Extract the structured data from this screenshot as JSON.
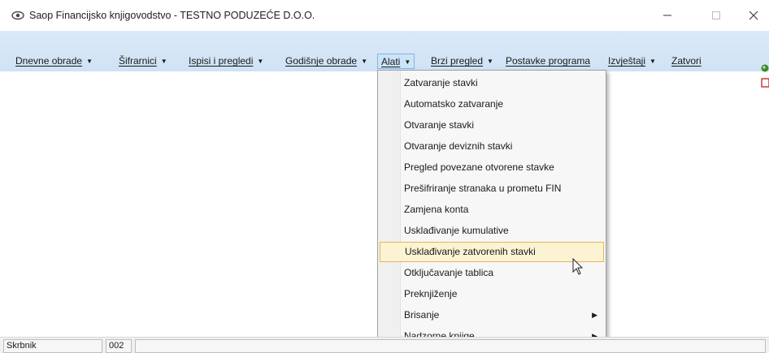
{
  "window": {
    "title": "Saop Financijsko knjigovodstvo - TESTNO PODUZEĆE D.O.O."
  },
  "menubar": {
    "items": [
      {
        "label": "Dnevne obrade"
      },
      {
        "label": "Šifrarnici"
      },
      {
        "label": "Ispisi i pregledi"
      },
      {
        "label": "Godišnje obrade"
      },
      {
        "label": "Alati"
      },
      {
        "label": "Brzi pregled"
      },
      {
        "label": "Postavke programa"
      },
      {
        "label": "Izvještaji"
      },
      {
        "label": "Zatvori"
      }
    ]
  },
  "alati_menu": {
    "items": [
      {
        "label": "Zatvaranje stavki"
      },
      {
        "label": "Automatsko zatvaranje"
      },
      {
        "label": "Otvaranje stavki"
      },
      {
        "label": "Otvaranje deviznih stavki"
      },
      {
        "label": "Pregled povezane otvorene stavke"
      },
      {
        "label": "Prešifriranje stranaka u prometu FIN"
      },
      {
        "label": "Zamjena konta"
      },
      {
        "label": "Usklađivanje kumulative"
      },
      {
        "label": "Usklađivanje zatvorenih stavki",
        "highlighted": true
      },
      {
        "label": "Otključavanje tablica"
      },
      {
        "label": "Preknjiženje"
      },
      {
        "label": "Brisanje",
        "submenu": true
      },
      {
        "label": "Nadzorne knjige",
        "submenu": true
      }
    ]
  },
  "statusbar": {
    "user": "Skrbnik",
    "code": "002"
  },
  "colors": {
    "menubar_bg": "#cfe2f5",
    "highlight_bg": "#fbf3d4",
    "highlight_border": "#e6b84a"
  }
}
